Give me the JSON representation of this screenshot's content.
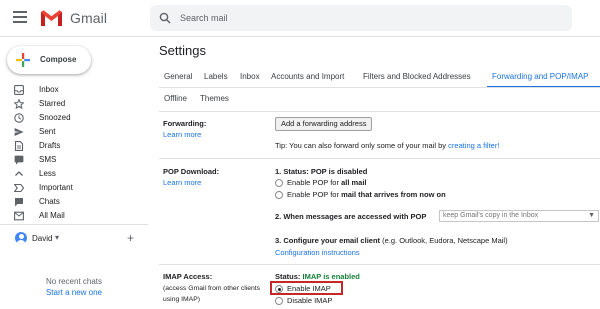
{
  "app": {
    "name": "Gmail",
    "logo_icon": "gmail-m-logo-icon"
  },
  "search": {
    "placeholder": "Search mail"
  },
  "sidebar": {
    "compose_label": "Compose",
    "items": [
      {
        "label": "Inbox",
        "icon": "inbox-icon"
      },
      {
        "label": "Starred",
        "icon": "star-icon"
      },
      {
        "label": "Snoozed",
        "icon": "clock-icon"
      },
      {
        "label": "Sent",
        "icon": "send-icon"
      },
      {
        "label": "Drafts",
        "icon": "draft-icon"
      },
      {
        "label": "SMS",
        "icon": "sms-icon"
      },
      {
        "label": "Less",
        "icon": "chevron-up-icon"
      },
      {
        "label": "Important",
        "icon": "important-icon"
      },
      {
        "label": "Chats",
        "icon": "chat-icon"
      },
      {
        "label": "All Mail",
        "icon": "all-mail-icon"
      }
    ],
    "user_name": "David",
    "user_caret": "▾",
    "add_chat": "+",
    "no_chats": "No recent chats",
    "new_chat": "Start a new one"
  },
  "settings": {
    "title": "Settings",
    "tabs": [
      "General",
      "Labels",
      "Inbox",
      "Accounts and Import",
      "Filters and Blocked Addresses",
      "Forwarding and POP/IMAP"
    ],
    "tabs_row2": [
      "Offline",
      "Themes"
    ],
    "active_tab": "Forwarding and POP/IMAP",
    "forwarding": {
      "title": "Forwarding:",
      "learn_more": "Learn more",
      "button": "Add a forwarding address",
      "tip_prefix": "Tip: You can also forward only some of your mail by ",
      "tip_link": "creating a filter!"
    },
    "pop": {
      "title": "POP Download:",
      "learn_more": "Learn more",
      "status": "1. Status: POP is disabled",
      "opt1_prefix": "Enable POP for ",
      "opt1_bold": "all mail",
      "opt2_prefix": "Enable POP for ",
      "opt2_bold": "mail that arrives from now on",
      "q2": "2. When messages are accessed with POP",
      "q2_select": "keep Gmail's copy in the Inbox",
      "q3_bold": "3. Configure your email client",
      "q3_rest": " (e.g. Outlook, Eudora, Netscape Mail)",
      "config_link": "Configuration instructions"
    },
    "imap": {
      "title": "IMAP Access:",
      "note_line1": "(access Gmail from other clients",
      "note_line2": "using IMAP)",
      "status_label": "Status: ",
      "status_value": "IMAP is enabled",
      "enable": "Enable IMAP",
      "disable": "Disable IMAP",
      "selected": "Enable IMAP"
    }
  },
  "colors": {
    "accent": "#1a73e8",
    "status_green": "#188038",
    "highlight_red": "#c62828",
    "gmail_red": "#ea4335"
  }
}
